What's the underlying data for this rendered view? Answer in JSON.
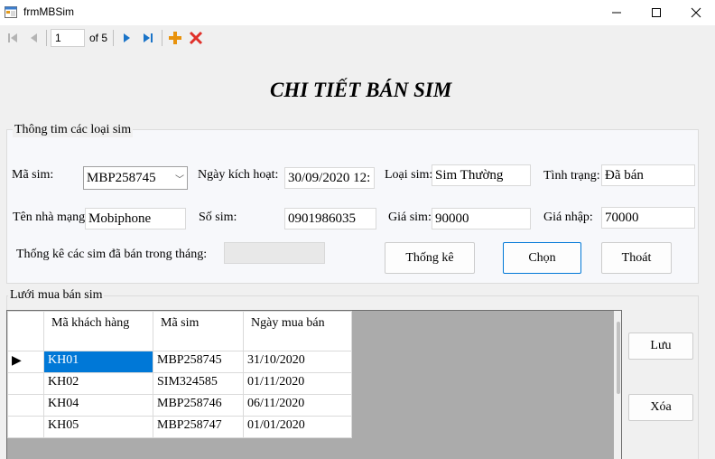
{
  "window": {
    "title": "frmMBSim",
    "minimize_glyph": "—",
    "maximize_glyph": "☐",
    "close_glyph": "✕"
  },
  "navigator": {
    "position": "1",
    "count_text": "of 5",
    "icons": [
      "move-first-icon",
      "move-previous-icon",
      "move-next-icon",
      "move-last-icon",
      "add-new-icon",
      "delete-icon"
    ]
  },
  "header": {
    "title": "CHI TIẾT BÁN SIM"
  },
  "info_group": {
    "legend": "Thông tim các loại sim",
    "ma_sim_label": "Mã sim:",
    "ma_sim_value": "MBP258745",
    "ngay_kich_hoat_label": "Ngày kích hoạt:",
    "ngay_kich_hoat_value": "30/09/2020 12:",
    "loai_sim_label": "Loại sim:",
    "loai_sim_value": "Sim Thường",
    "tinh_trang_label": "Tình trạng:",
    "tinh_trang_value": "Đã bán",
    "nha_mang_label": "Tên nhà mạng",
    "nha_mang_value": "Mobiphone",
    "so_sim_label": "Số sim:",
    "so_sim_value": "0901986035",
    "gia_sim_label": "Giá sim:",
    "gia_sim_value": "90000",
    "gia_nhap_label": "Giá nhập:",
    "gia_nhap_value": "70000",
    "thong_ke_label": "Thống kê các sim đã bán trong tháng:",
    "thong_ke_button": "Thống kê",
    "chon_button": "Chọn",
    "thoat_button": "Thoát"
  },
  "grid_group": {
    "legend": "Lưới mua bán sim",
    "columns": [
      "Mã khách hàng",
      "Mã sim",
      "Ngày mua bán"
    ],
    "rows": [
      [
        "KH01",
        "MBP258745",
        "31/10/2020"
      ],
      [
        "KH02",
        "SIM324585",
        "01/11/2020"
      ],
      [
        "KH04",
        "MBP258746",
        "06/11/2020"
      ],
      [
        "KH05",
        "MBP258747",
        "01/01/2020"
      ]
    ],
    "current_row_marker": "▶",
    "luu_button": "Lưu",
    "xoa_button": "Xóa"
  },
  "colors": {
    "selection": "#0078d7",
    "grid_background": "#ababab",
    "add_icon": "#e8920c",
    "delete_icon": "#e0302a",
    "nav_icon": "#1a74c8"
  }
}
